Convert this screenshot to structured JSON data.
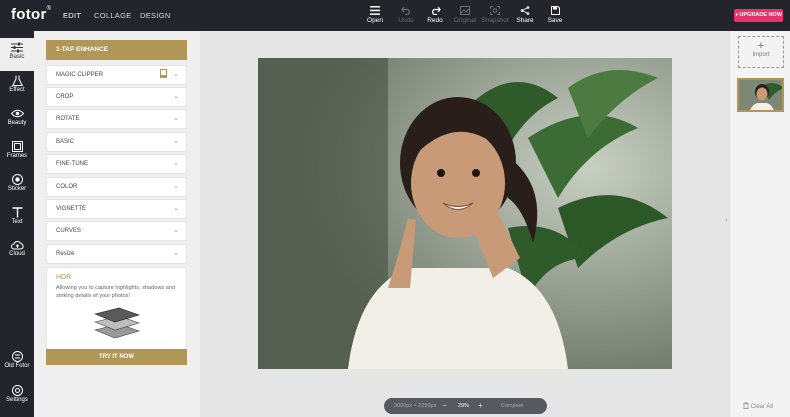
{
  "app": {
    "logo": "fotor",
    "logo_mark": "®"
  },
  "topnav": [
    {
      "label": "EDIT",
      "active": true
    },
    {
      "label": "COLLAGE",
      "active": false
    },
    {
      "label": "DESIGN",
      "active": false
    }
  ],
  "toolbar": [
    {
      "label": "Open",
      "icon": "menu-icon",
      "enabled": true
    },
    {
      "label": "Undo",
      "icon": "undo-icon",
      "enabled": false
    },
    {
      "label": "Redo",
      "icon": "redo-icon",
      "enabled": true
    },
    {
      "label": "Original",
      "icon": "original-icon",
      "enabled": false
    },
    {
      "label": "Snapshot",
      "icon": "snapshot-icon",
      "enabled": false
    },
    {
      "label": "Share",
      "icon": "share-icon",
      "enabled": true
    },
    {
      "label": "Save",
      "icon": "save-icon",
      "enabled": true
    }
  ],
  "upgrade": {
    "label": "UPGRADE NOW",
    "color": "#e8336a"
  },
  "sidebar": {
    "items": [
      {
        "label": "Basic",
        "icon": "sliders-icon",
        "active": true
      },
      {
        "label": "Effect",
        "icon": "flask-icon",
        "active": false
      },
      {
        "label": "Beauty",
        "icon": "eye-icon",
        "active": false
      },
      {
        "label": "Frames",
        "icon": "frame-icon",
        "active": false
      },
      {
        "label": "Sticker",
        "icon": "sticker-icon",
        "active": false
      },
      {
        "label": "Text",
        "icon": "text-icon",
        "active": false
      },
      {
        "label": "Cloud",
        "icon": "cloud-icon",
        "active": false
      }
    ],
    "bottom": [
      {
        "label": "Old Fotor",
        "icon": "old-fotor-icon"
      },
      {
        "label": "Settings",
        "icon": "settings-icon"
      }
    ]
  },
  "panel": {
    "enhance_label": "1-TAP ENHANCE",
    "accordion": [
      {
        "label": "MAGIC CLIPPER",
        "premium": true
      },
      {
        "label": "CROP"
      },
      {
        "label": "ROTATE"
      },
      {
        "label": "BASIC"
      },
      {
        "label": "FINE-TUNE"
      },
      {
        "label": "COLOR"
      },
      {
        "label": "VIGNETTE"
      },
      {
        "label": "CURVES"
      },
      {
        "label": "Resize"
      }
    ],
    "hdr": {
      "title": "HDR",
      "description": "Allowing you to capture highlights, shadows and striking details of your photos!",
      "cta": "TRY IT NOW"
    },
    "accent": "#b09657"
  },
  "canvas": {
    "size_text": "3000px × 2250px",
    "zoom": "29%",
    "zoom_out": "−",
    "zoom_in": "+",
    "compare": "Compare"
  },
  "right_panel": {
    "import_label": "Import",
    "import_plus": "+",
    "clear_all": "Clear All"
  }
}
